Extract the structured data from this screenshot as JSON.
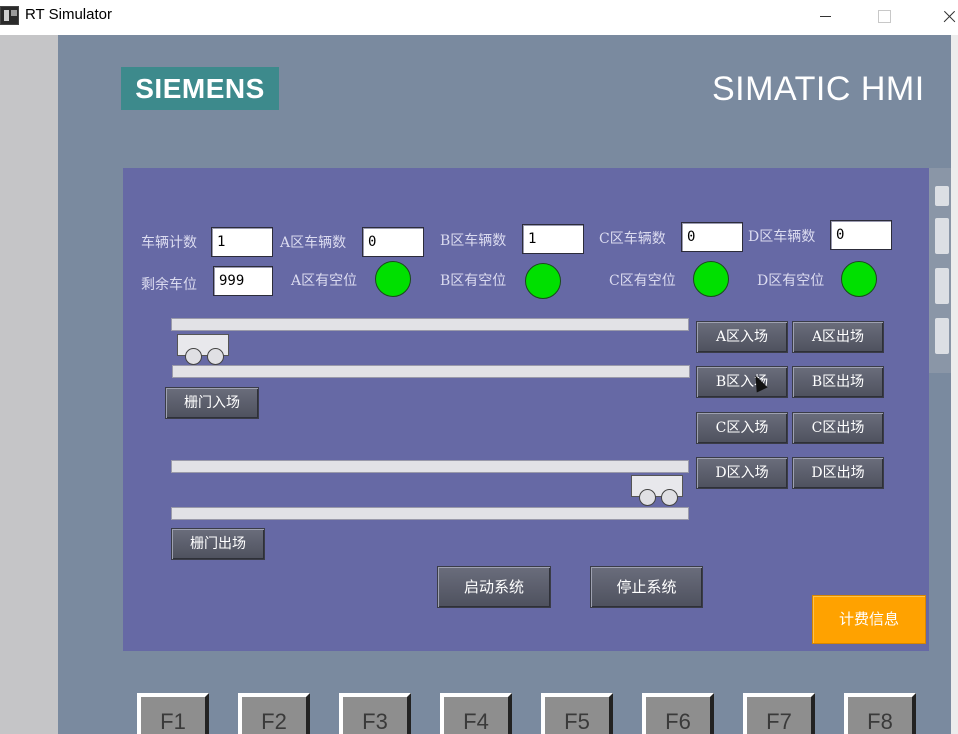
{
  "window": {
    "title": "RT Simulator",
    "icon": "app-icon"
  },
  "header": {
    "brand": "SIEMENS",
    "product": "SIMATIC HMI"
  },
  "counters": {
    "vehicle_count_label": "车辆计数",
    "vehicle_count_value": "1",
    "remaining_label": "剩余车位",
    "remaining_value": "999",
    "a_count_label": "A区车辆数",
    "a_count_value": "0",
    "b_count_label": "B区车辆数",
    "b_count_value": "1",
    "c_count_label": "C区车辆数",
    "c_count_value": "0",
    "d_count_label": "D区车辆数",
    "d_count_value": "0"
  },
  "indicators": {
    "a_label": "A区有空位",
    "b_label": "B区有空位",
    "c_label": "C区有空位",
    "d_label": "D区有空位",
    "color": "#00e000"
  },
  "buttons": {
    "a_in": "A区入场",
    "a_out": "A区出场",
    "b_in": "B区入场",
    "b_out": "B区出场",
    "c_in": "C区入场",
    "c_out": "C区出场",
    "d_in": "D区入场",
    "d_out": "D区出场",
    "gate_in": "栅门入场",
    "gate_out": "栅门出场",
    "start": "启动系统",
    "stop": "停止系统",
    "billing": "计费信息"
  },
  "fkeys": [
    "F1",
    "F2",
    "F3",
    "F4",
    "F5",
    "F6",
    "F7",
    "F8"
  ],
  "colors": {
    "device_bg": "#7a8a9f",
    "screen_bg": "#6669a5",
    "brand_bg": "#3d8a8c",
    "billing_bg": "#ffa200"
  }
}
